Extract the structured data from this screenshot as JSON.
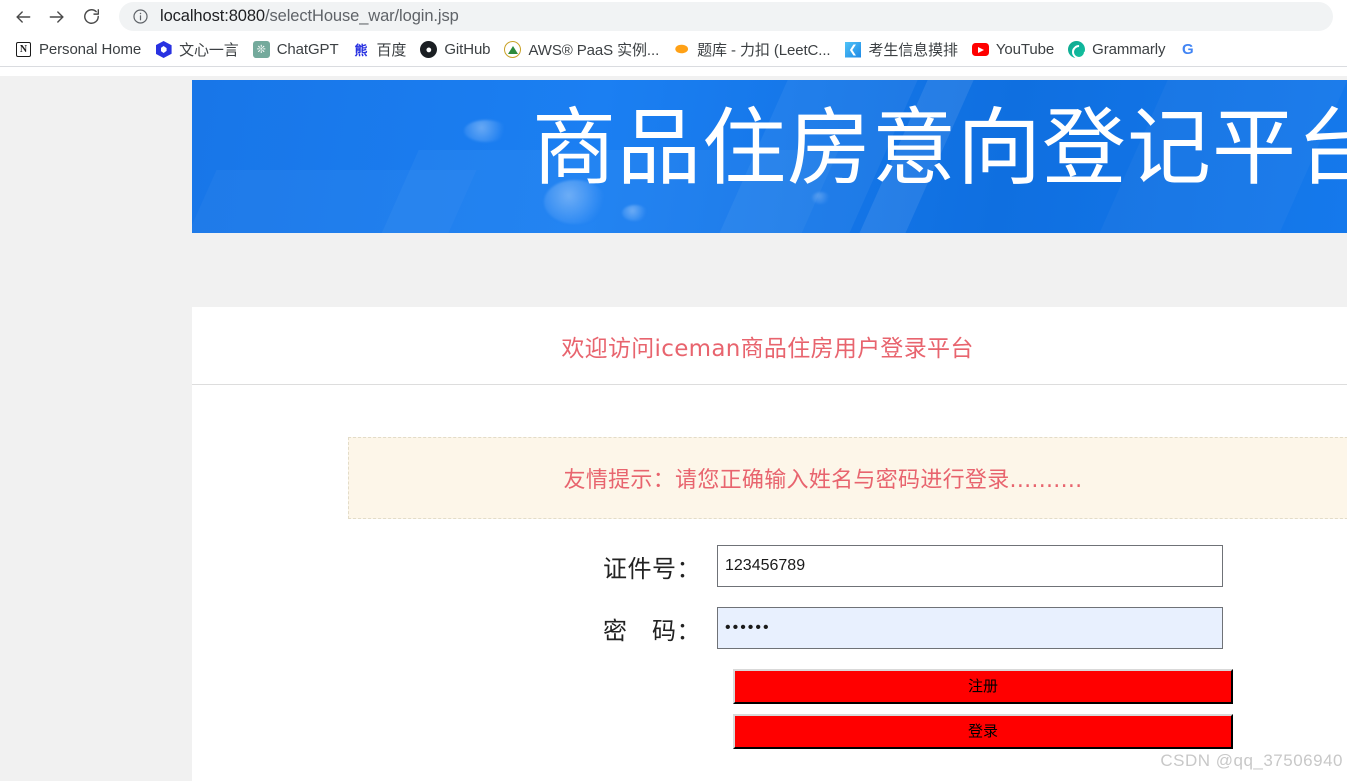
{
  "browser": {
    "nav": {
      "back_label": "Back",
      "forward_label": "Forward",
      "reload_label": "Reload"
    },
    "omnibox": {
      "site_info_icon": "info-circle-icon",
      "url_host": "localhost:8080",
      "url_path": "/selectHouse_war/login.jsp",
      "url_full": "localhost:8080/selectHouse_war/login.jsp"
    },
    "bookmarks": [
      {
        "label": "Personal Home",
        "icon": "notion-icon"
      },
      {
        "label": "文心一言",
        "icon": "ernie-bot-icon"
      },
      {
        "label": "ChatGPT",
        "icon": "chatgpt-icon"
      },
      {
        "label": "百度",
        "icon": "baidu-icon"
      },
      {
        "label": "GitHub",
        "icon": "github-icon"
      },
      {
        "label": "AWS® PaaS 实例...",
        "icon": "aws-icon"
      },
      {
        "label": "题库 - 力扣 (LeetC...",
        "icon": "leetcode-icon"
      },
      {
        "label": "考生信息摸排",
        "icon": "kaosheng-icon"
      },
      {
        "label": "YouTube",
        "icon": "youtube-icon"
      },
      {
        "label": "Grammarly",
        "icon": "grammarly-icon"
      },
      {
        "label": "",
        "icon": "google-icon"
      }
    ]
  },
  "page": {
    "banner": {
      "title": "商品住房意向登记平台",
      "background_color": "#1876e8"
    },
    "welcome": {
      "text": "欢迎访问iceman商品住房用户登录平台",
      "color": "#e8646e"
    },
    "alert": {
      "text": "友情提示：请您正确输入姓名与密码进行登录..........",
      "background_color": "#fdf6e9",
      "color": "#e8646e"
    },
    "form": {
      "fields": [
        {
          "label": "证件号：",
          "name": "id-number-input",
          "type": "text",
          "value": "123456789",
          "placeholder": ""
        },
        {
          "label": "密　码：",
          "name": "password-input",
          "type": "password",
          "value": "••••••",
          "placeholder": ""
        }
      ],
      "buttons": [
        {
          "label": "注册",
          "name": "register-button",
          "color": "#ff0000"
        },
        {
          "label": "登录",
          "name": "login-button",
          "color": "#ff0000"
        }
      ]
    },
    "watermark": "CSDN @qq_37506940"
  }
}
